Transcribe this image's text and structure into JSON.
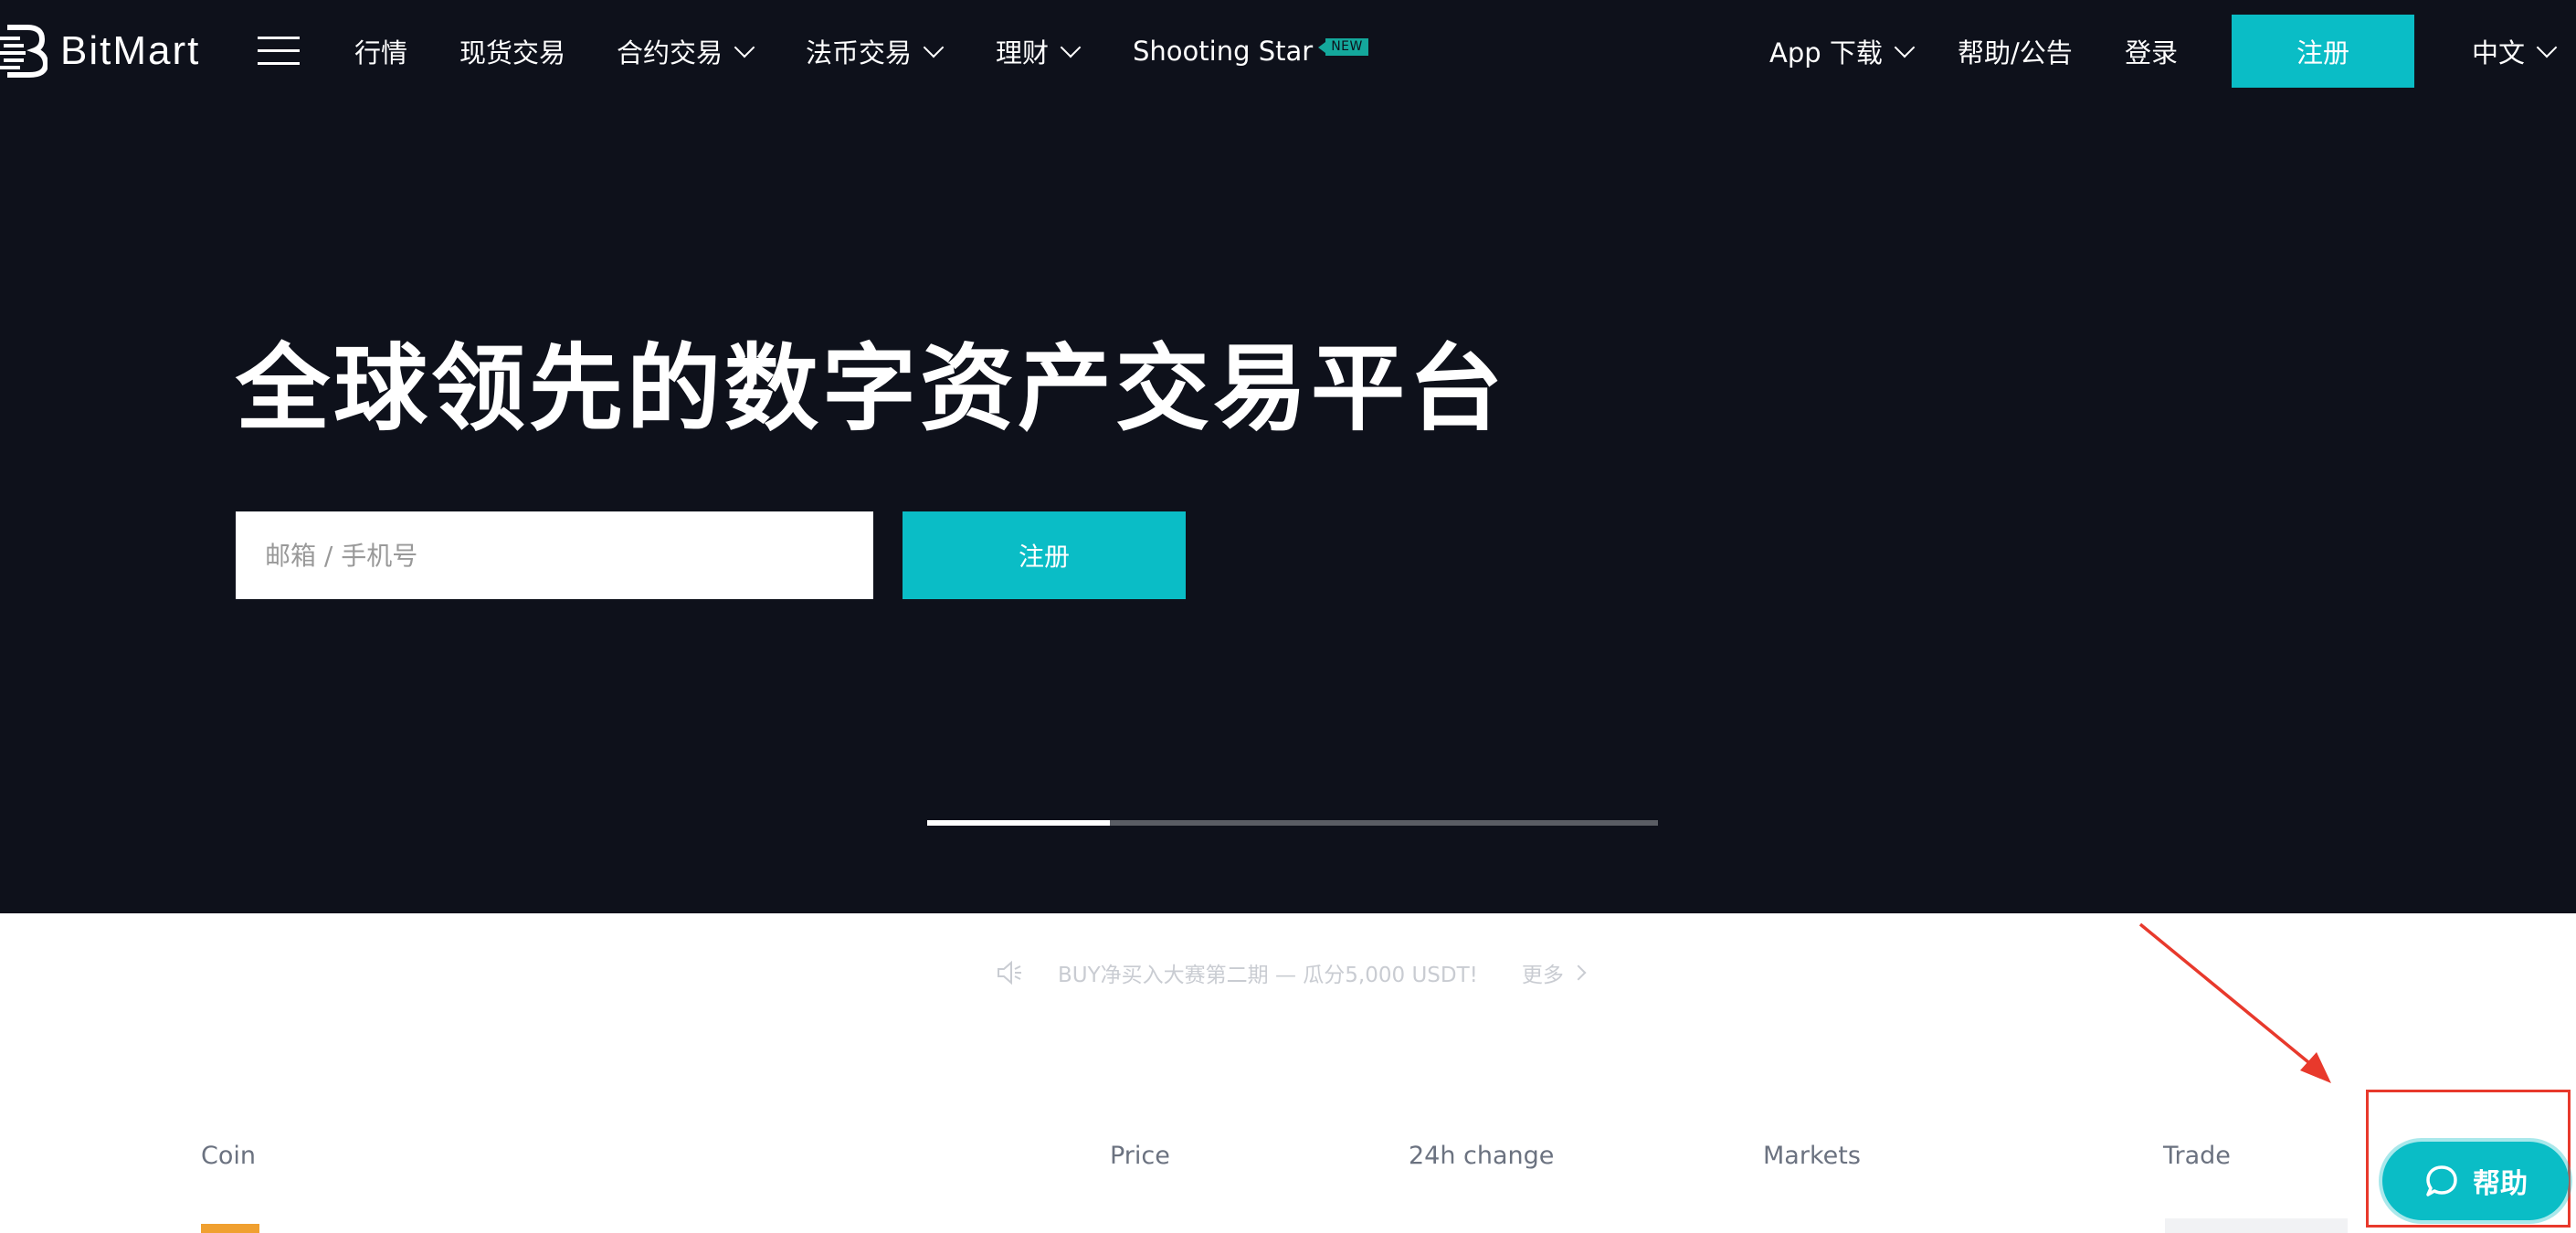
{
  "nav": {
    "logo_text": "BitMart",
    "items": [
      {
        "label": "行情"
      },
      {
        "label": "现货交易"
      },
      {
        "label": "合约交易"
      },
      {
        "label": "法币交易"
      },
      {
        "label": "理财"
      },
      {
        "label": "Shooting Star"
      }
    ],
    "new_badge": "NEW",
    "app_download": "App 下载",
    "help_announcement": "帮助/公告",
    "login": "登录",
    "register": "注册",
    "language": "中文"
  },
  "hero": {
    "title": "全球领先的数字资产交易平台",
    "input_placeholder": "邮箱 / 手机号",
    "register_button": "注册",
    "carousel_progress": 0.25
  },
  "announcement": {
    "text": "BUY净买入大赛第二期 — 瓜分5,000 USDT!",
    "more": "更多"
  },
  "market_table": {
    "columns": [
      "Coin",
      "Price",
      "24h change",
      "Markets",
      "Trade"
    ]
  },
  "help_widget": {
    "label": "帮助"
  },
  "colors": {
    "accent": "#0abdc6",
    "nav_bg": "#0e111b",
    "annotation": "#e8392c"
  }
}
